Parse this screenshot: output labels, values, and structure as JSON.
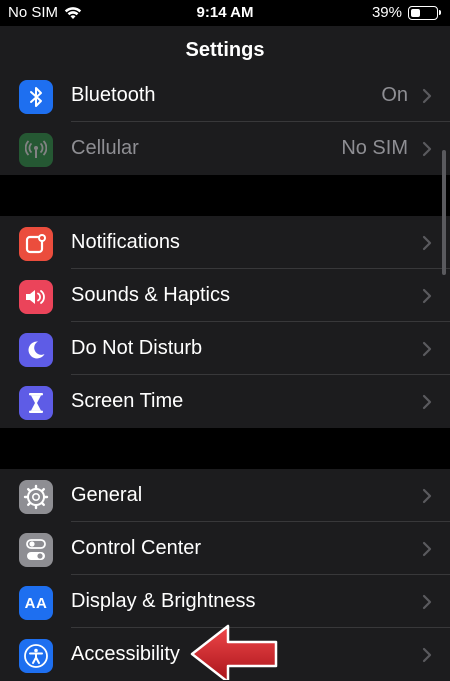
{
  "status_bar": {
    "carrier": "No SIM",
    "time": "9:14 AM",
    "battery_percent": "39%",
    "battery_level": 0.39
  },
  "nav": {
    "title": "Settings"
  },
  "groups": [
    {
      "items": [
        {
          "label": "Bluetooth",
          "value": "On",
          "icon": "bluetooth-icon",
          "color": "#1e6ff0"
        },
        {
          "label": "Cellular",
          "value": "No SIM",
          "icon": "antenna-icon",
          "color": "#30a14e",
          "disabled": true
        }
      ]
    },
    {
      "items": [
        {
          "label": "Notifications",
          "icon": "notifications-icon",
          "color": "#eb4d3d"
        },
        {
          "label": "Sounds & Haptics",
          "icon": "speaker-icon",
          "color": "#eb445a"
        },
        {
          "label": "Do Not Disturb",
          "icon": "moon-icon",
          "color": "#5e5ce6"
        },
        {
          "label": "Screen Time",
          "icon": "hourglass-icon",
          "color": "#5e5ce6"
        }
      ]
    },
    {
      "items": [
        {
          "label": "General",
          "icon": "gear-icon",
          "color": "#8e8e93"
        },
        {
          "label": "Control Center",
          "icon": "toggles-icon",
          "color": "#8e8e93"
        },
        {
          "label": "Display & Brightness",
          "icon": "aa-icon",
          "color": "#1e6ff0",
          "icon_text": "AA"
        },
        {
          "label": "Accessibility",
          "icon": "accessibility-icon",
          "color": "#1e6ff0"
        }
      ]
    }
  ],
  "annotation": {
    "icon": "red-arrow-icon",
    "color": "#d8262a"
  }
}
